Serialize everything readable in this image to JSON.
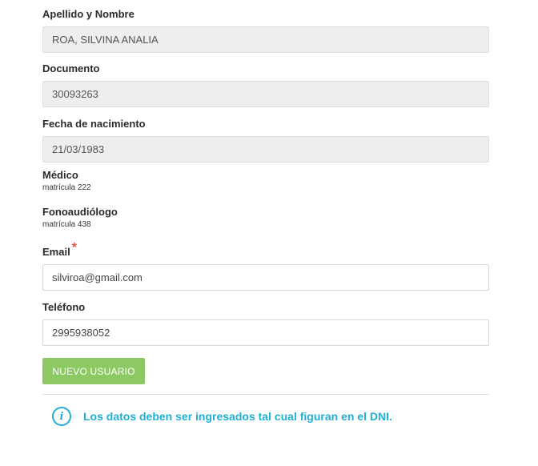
{
  "fields": {
    "name": {
      "label": "Apellido y Nombre",
      "value": "ROA, SILVINA ANALIA"
    },
    "document": {
      "label": "Documento",
      "value": "30093263"
    },
    "birthdate": {
      "label": "Fecha de nacimiento",
      "value": "21/03/1983"
    },
    "email": {
      "label": "Email",
      "required_mark": "*",
      "value": "silviroa@gmail.com"
    },
    "phone": {
      "label": "Teléfono",
      "value": "2995938052"
    }
  },
  "professionals": {
    "medico": {
      "title": "Médico",
      "subtitle": "matrícula 222"
    },
    "fonoaudiologo": {
      "title": "Fonoaudiólogo",
      "subtitle": "matrícula 438"
    }
  },
  "actions": {
    "submit_label": "NUEVO USUARIO"
  },
  "notice": {
    "icon": "info-icon",
    "text": "Los datos deben ser ingresados tal cual figuran en el DNI."
  },
  "colors": {
    "accent_button": "#8cc963",
    "info": "#1fb0d8",
    "required": "#e8523f",
    "readonly_bg": "#eeeeee"
  }
}
